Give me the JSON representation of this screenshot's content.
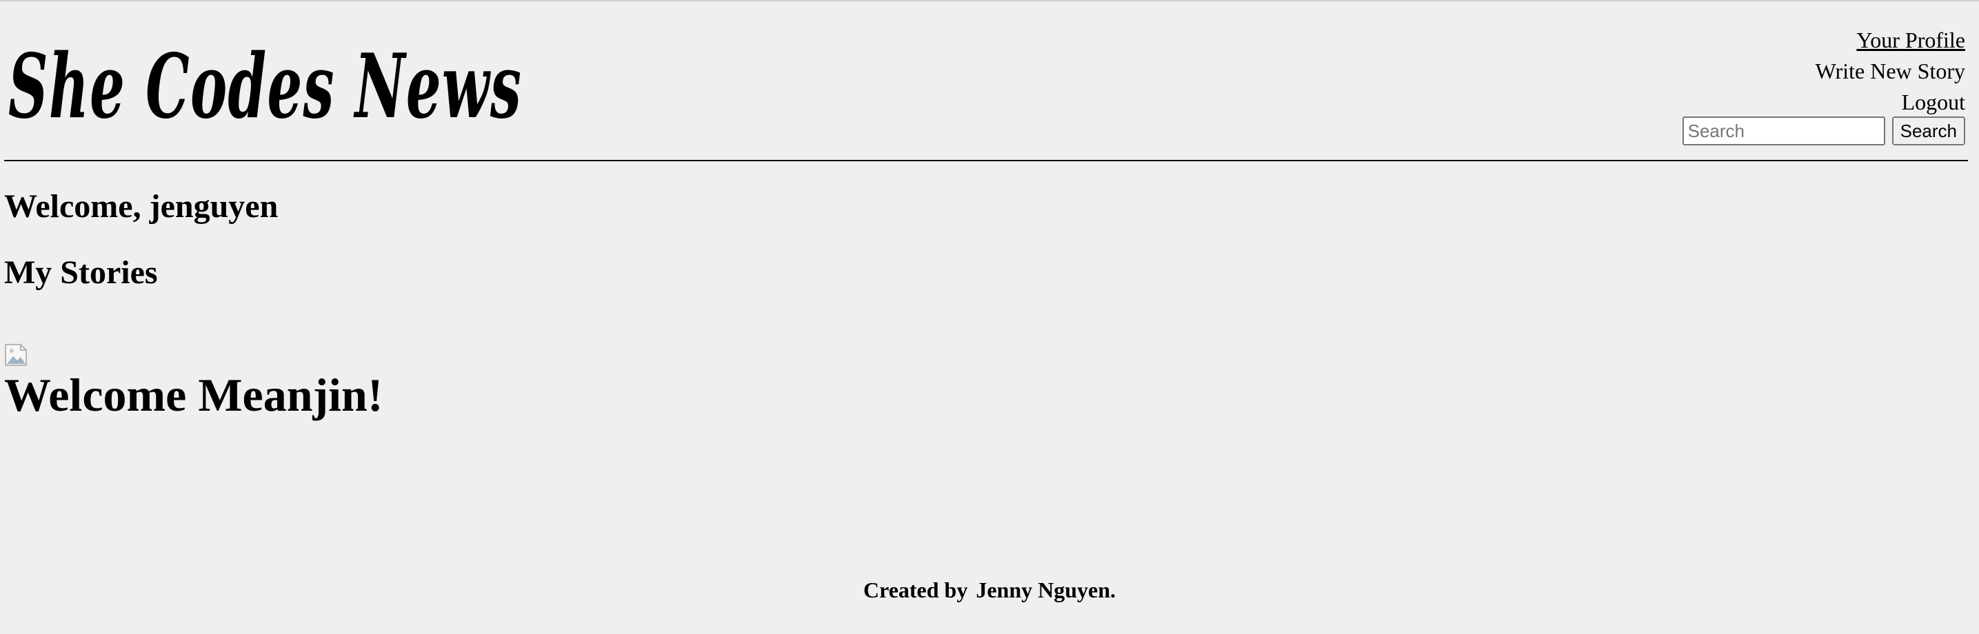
{
  "header": {
    "logo_text": "She Codes News",
    "nav": {
      "profile_label": "Your Profile",
      "write_label": "Write New Story",
      "logout_label": "Logout"
    },
    "search": {
      "placeholder": "Search",
      "value": "",
      "button_label": "Search"
    }
  },
  "main": {
    "welcome_text": "Welcome, jenguyen",
    "section_title": "My Stories",
    "stories": [
      {
        "title": "Welcome Meanjin!",
        "image": "broken-image-icon"
      }
    ]
  },
  "footer": {
    "created_prefix": "Created by",
    "author": "Jenny Nguyen."
  }
}
